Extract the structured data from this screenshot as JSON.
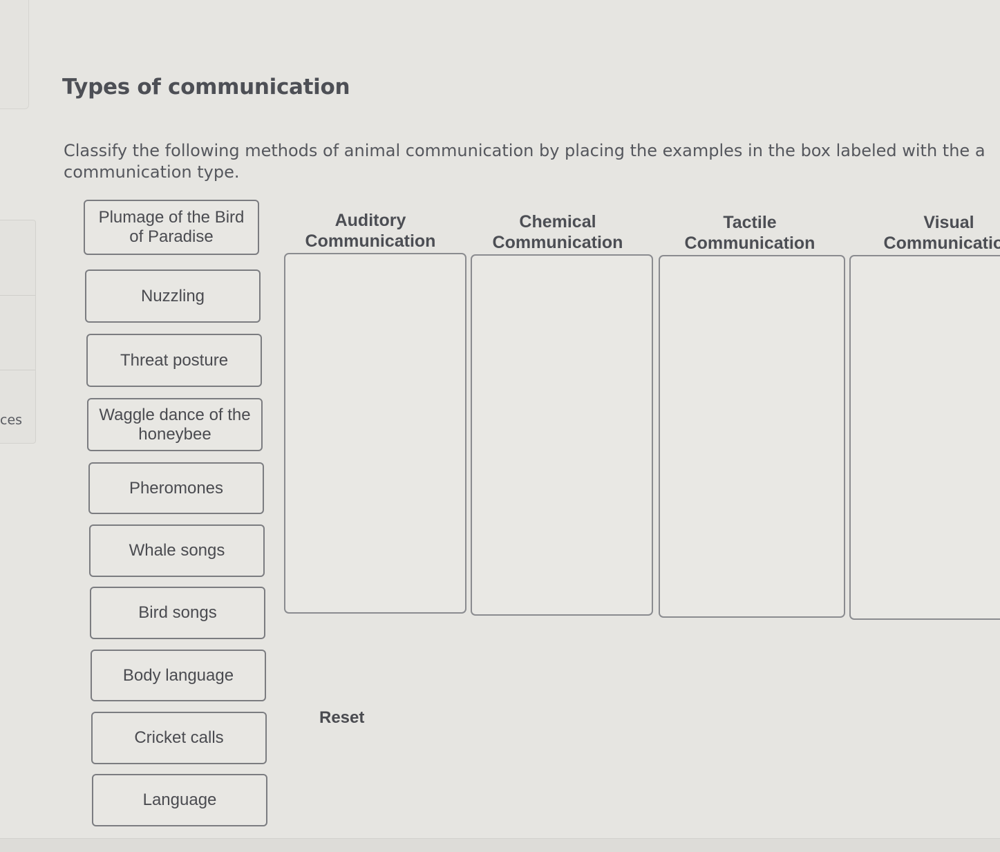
{
  "page": {
    "title": "Types of communication",
    "instructions_line1": "Classify the following methods of animal communication by placing the examples in the box labeled with the a",
    "instructions_line2": "communication type."
  },
  "left_nav": {
    "partial_label": "ces"
  },
  "cards": [
    {
      "label": "Plumage of the Bird of Paradise"
    },
    {
      "label": "Nuzzling"
    },
    {
      "label": "Threat posture"
    },
    {
      "label": "Waggle dance of the honeybee"
    },
    {
      "label": "Pheromones"
    },
    {
      "label": "Whale songs"
    },
    {
      "label": "Bird songs"
    },
    {
      "label": "Body language"
    },
    {
      "label": "Cricket calls"
    },
    {
      "label": "Language"
    }
  ],
  "categories": [
    {
      "line1": "Auditory",
      "line2": "Communication",
      "items": []
    },
    {
      "line1": "Chemical",
      "line2": "Communication",
      "items": []
    },
    {
      "line1": "Tactile",
      "line2": "Communication",
      "items": []
    },
    {
      "line1": "Visual",
      "line2": "Communication",
      "items": []
    }
  ],
  "actions": {
    "reset_label": "Reset"
  }
}
